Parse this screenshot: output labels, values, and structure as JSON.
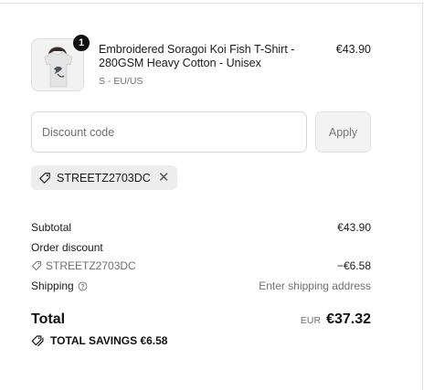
{
  "line_item": {
    "quantity": "1",
    "title": "Embroidered Soragoi Koi Fish T-Shirt - 280GSM Heavy Cotton - Unisex",
    "variant": "S - EU/US",
    "price": "€43.90"
  },
  "discount": {
    "placeholder": "Discount code",
    "apply_label": "Apply",
    "applied_code": "STREETZ2703DC",
    "remove_glyph": "✕"
  },
  "summary": {
    "subtotal_label": "Subtotal",
    "subtotal_value": "€43.90",
    "order_discount_label": "Order discount",
    "order_discount_code": "STREETZ2703DC",
    "order_discount_value": "−€6.58",
    "shipping_label": "Shipping",
    "shipping_value": "Enter shipping address",
    "total_label": "Total",
    "currency": "EUR",
    "total_value": "€37.32",
    "savings_label": "TOTAL SAVINGS €6.58"
  },
  "icons": {
    "tag": "tag-icon",
    "help": "help-circle-icon",
    "close": "close-icon",
    "tags": "tags-icon"
  },
  "colors": {
    "text": "#111111",
    "muted": "#707070",
    "chip_bg": "#ededed",
    "apply_bg": "#f3f3f3"
  }
}
